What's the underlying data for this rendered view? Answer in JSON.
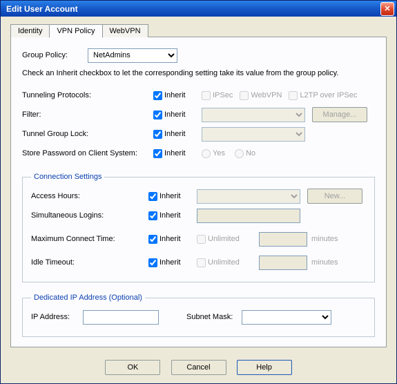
{
  "window": {
    "title": "Edit User Account"
  },
  "tabs": {
    "t0": "Identity",
    "t1": "VPN Policy",
    "t2": "WebVPN"
  },
  "group_policy": {
    "label": "Group Policy:",
    "value": "NetAdmins"
  },
  "help": "Check an Inherit checkbox to let the corresponding setting take its value from the group policy.",
  "inherit": "Inherit",
  "tunneling": {
    "label": "Tunneling Protocols:",
    "ipsec": "IPSec",
    "webvpn": "WebVPN",
    "l2tp": "L2TP over IPSec"
  },
  "filter": {
    "label": "Filter:",
    "manage": "Manage..."
  },
  "tgl": {
    "label": "Tunnel Group Lock:"
  },
  "store_pw": {
    "label": "Store Password on Client System:",
    "yes": "Yes",
    "no": "No"
  },
  "conn": {
    "legend": "Connection Settings",
    "access_hours": {
      "label": "Access Hours:",
      "new": "New..."
    },
    "sim_logins": {
      "label": "Simultaneous Logins:"
    },
    "max_connect": {
      "label": "Maximum Connect Time:",
      "unlimited": "Unlimited",
      "unit": "minutes"
    },
    "idle": {
      "label": "Idle Timeout:",
      "unlimited": "Unlimited",
      "unit": "minutes"
    }
  },
  "ded_ip": {
    "legend": "Dedicated IP Address (Optional)",
    "ip_label": "IP Address:",
    "mask_label": "Subnet Mask:"
  },
  "buttons": {
    "ok": "OK",
    "cancel": "Cancel",
    "help": "Help"
  }
}
